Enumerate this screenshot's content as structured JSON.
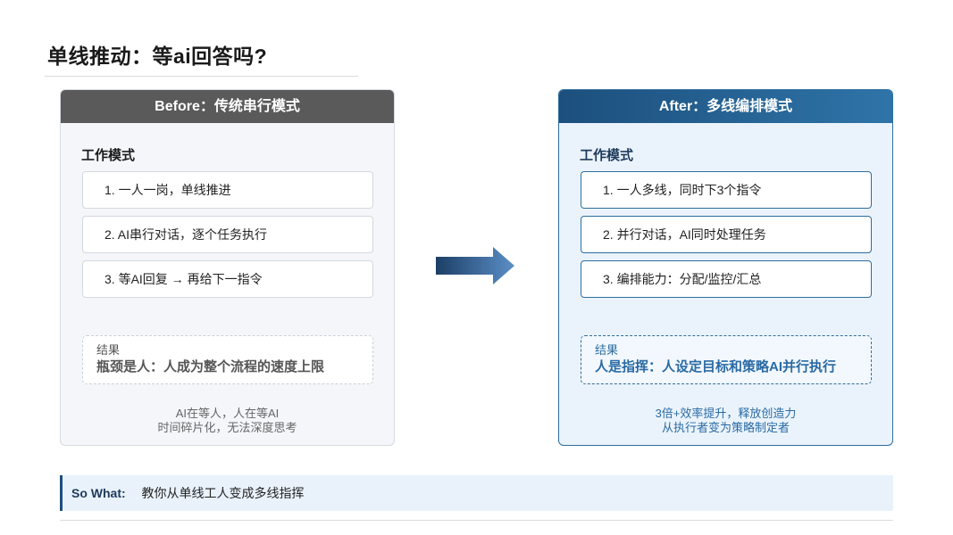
{
  "page": {
    "title": "单线推动：等ai回答吗?"
  },
  "before": {
    "header": "Before：传统串行模式",
    "section_label": "工作模式",
    "items": [
      {
        "label": "1. 一人一岗，单线推进"
      },
      {
        "label": "2. AI串行对话，逐个任务执行"
      },
      {
        "label": "3. 等AI回复 → 再给下一指令"
      }
    ],
    "result_label": "结果",
    "result_text": "瓶颈是人：人成为整个流程的速度上限",
    "footnote": [
      "AI在等人，人在等AI",
      "时间碎片化，无法深度思考"
    ]
  },
  "after": {
    "header": "After：多线编排模式",
    "section_label": "工作模式",
    "items": [
      {
        "label": "1. 一人多线，同时下3个指令"
      },
      {
        "label": "2. 并行对话，AI同时处理任务"
      },
      {
        "label": "3. 编排能力：分配/监控/汇总"
      }
    ],
    "result_label": "结果",
    "result_text": "人是指挥：人设定目标和策略AI并行执行",
    "footnote": [
      "3倍+效率提升，释放创造力",
      "从执行者变为策略制定者"
    ]
  },
  "arrow": {
    "icon": "right-arrow-icon",
    "color_start": "#1c3f66",
    "color_end": "#5b8fc7"
  },
  "so_what": {
    "label": "So What:",
    "text": "教你从单线工人变成多线指挥"
  },
  "colors": {
    "before_header": "#5a5a5a",
    "after_header": "#1c4f7d",
    "accent": "#2a6aa4"
  }
}
